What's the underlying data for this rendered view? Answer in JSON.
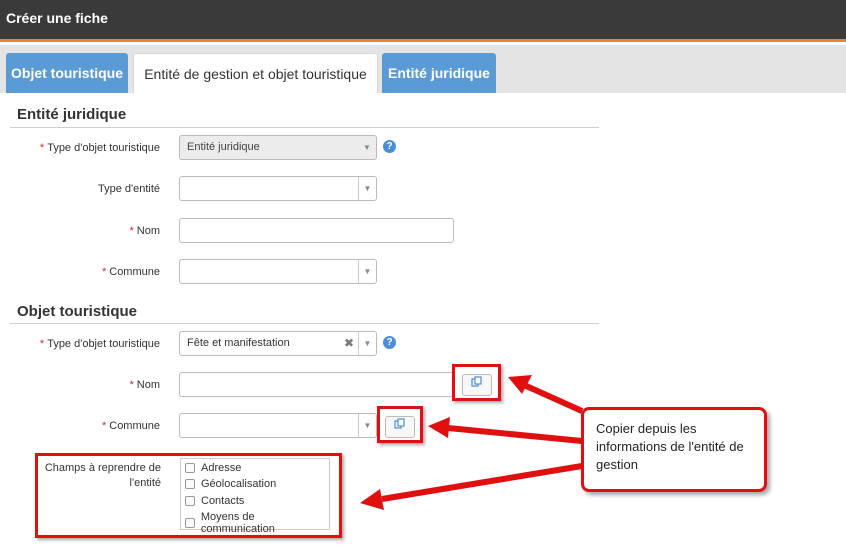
{
  "window": {
    "title": "Créer une fiche"
  },
  "tabs": [
    {
      "label": "Objet touristique"
    },
    {
      "label": "Entité de gestion et objet touristique"
    },
    {
      "label": "Entité juridique"
    }
  ],
  "entite_juridique": {
    "title": "Entité juridique",
    "type_objet": {
      "label": "Type d'objet touristique",
      "value": "Entité juridique"
    },
    "type_entite": {
      "label": "Type d'entité",
      "value": ""
    },
    "nom": {
      "label": "Nom",
      "value": ""
    },
    "commune": {
      "label": "Commune",
      "value": ""
    }
  },
  "objet_touristique": {
    "title": "Objet touristique",
    "type_objet": {
      "label": "Type d'objet touristique",
      "value": "Fête et manifestation"
    },
    "nom": {
      "label": "Nom",
      "value": ""
    },
    "commune": {
      "label": "Commune",
      "value": ""
    },
    "champs": {
      "label_line1": "Champs à reprendre de",
      "label_line2": "l'entité",
      "items": [
        "Adresse",
        "Géolocalisation",
        "Contacts",
        "Moyens de communication"
      ]
    }
  },
  "required_mark": "*",
  "help_glyph": "?",
  "callout": {
    "text": "Copier depuis les informations de l'entité de gestion"
  },
  "colors": {
    "accent": "#f0842c",
    "tab_blue": "#5b9bd5",
    "annotation_red": "#e01010"
  }
}
